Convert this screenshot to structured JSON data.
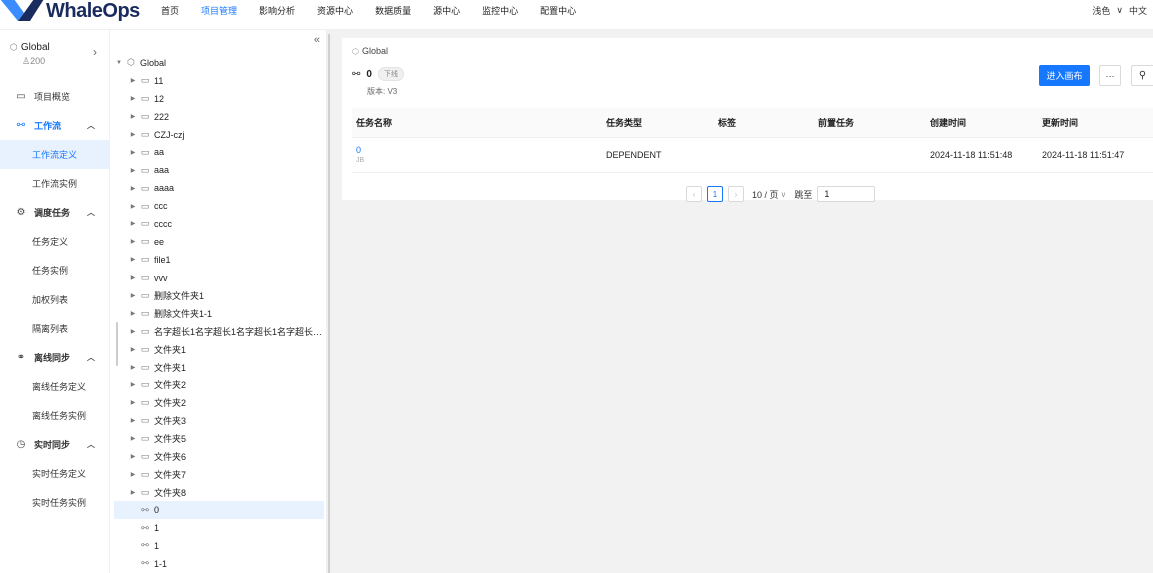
{
  "brand": {
    "name": "WhaleOps",
    "accent": "#1677ff"
  },
  "nav": [
    "首页",
    "项目管理",
    "影响分析",
    "资源中心",
    "数据质量",
    "源中心",
    "监控中心",
    "配置中心"
  ],
  "nav_active": "项目管理",
  "topright": {
    "theme": "浅色",
    "chevron": "∨",
    "lang": "中文"
  },
  "workspace": {
    "name": "Global",
    "count": "200"
  },
  "menu": {
    "overview": "项目概览",
    "workflow": "工作流",
    "workflow_def": "工作流定义",
    "workflow_inst": "工作流实例",
    "schedule": "调度任务",
    "task_def": "任务定义",
    "task_inst": "任务实例",
    "weight_list": "加权列表",
    "isolation_list": "隔离列表",
    "offline": "离线同步",
    "offline_def": "离线任务定义",
    "offline_inst": "离线任务实例",
    "realtime": "实时同步",
    "realtime_def": "实时任务定义",
    "realtime_inst": "实时任务实例"
  },
  "tree": {
    "collapse": "«",
    "root": "Global",
    "folders": [
      "11",
      "12",
      "222",
      "CZJ-czj",
      "aa",
      "aaa",
      "aaaa",
      "ccc",
      "cccc",
      "ee",
      "file1",
      "vvv",
      "删除文件夹1",
      "删除文件夹1-1",
      "名字超长1名字超长1名字超长1名字超长1名...",
      "文件夹1",
      "文件夹1",
      "文件夹2",
      "文件夹2",
      "文件夹3",
      "文件夹5",
      "文件夹6",
      "文件夹7",
      "文件夹8"
    ],
    "workflows": [
      "0",
      "1",
      "1",
      "1-1"
    ],
    "selected_workflow_index": 0
  },
  "detail": {
    "breadcrumb": "Global",
    "name": "0",
    "status": "下线",
    "version": "版本: V3",
    "enter_canvas": "进入画布",
    "more": "···",
    "search": "⚲"
  },
  "table": {
    "headers": [
      "任务名称",
      "任务类型",
      "标签",
      "前置任务",
      "创建时间",
      "更新时间"
    ],
    "rows": [
      {
        "name": "0",
        "id": "JB",
        "type": "DEPENDENT",
        "tag": "",
        "pre": "",
        "created": "2024-11-18 11:51:48",
        "updated": "2024-11-18 11:51:47"
      }
    ]
  },
  "pagination": {
    "prev": "‹",
    "page": "1",
    "next": "›",
    "size": "10 / 页",
    "size_caret": "∨",
    "jump_label": "跳至",
    "jump_value": "1"
  }
}
